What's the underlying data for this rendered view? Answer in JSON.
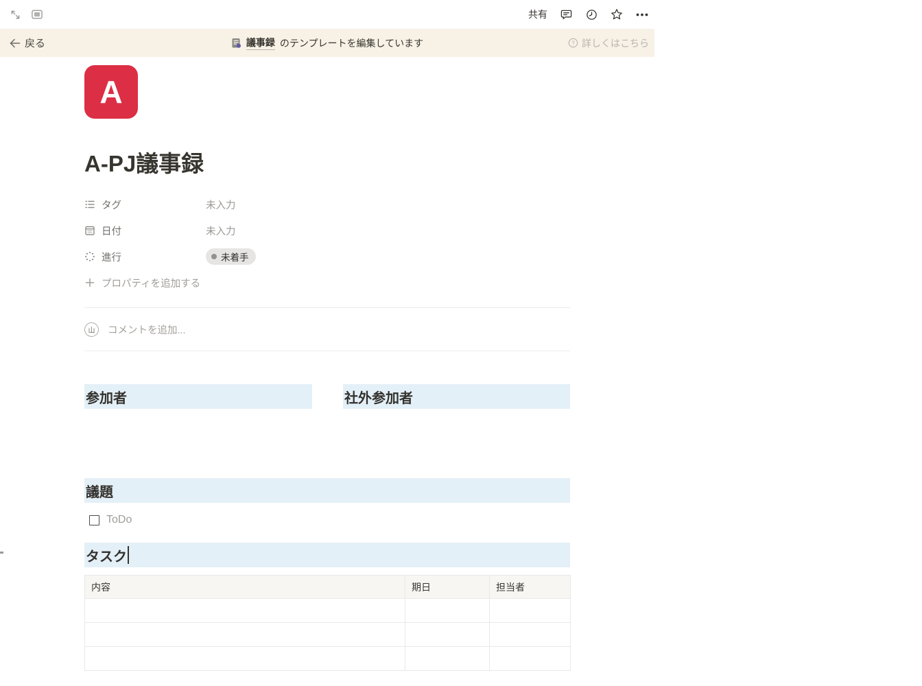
{
  "window": {
    "topbar": {
      "share_label": "共有"
    },
    "banner": {
      "back_label": "戻る",
      "doc_name": "議事録",
      "message_suffix": "のテンプレートを編集しています",
      "help_label": "詳しくはこちら"
    }
  },
  "page": {
    "icon_letter": "A",
    "title": "A-PJ議事録",
    "properties": [
      {
        "icon": "list-icon",
        "label": "タグ",
        "value": "未入力"
      },
      {
        "icon": "calendar-icon",
        "label": "日付",
        "value": "未入力"
      },
      {
        "icon": "status-icon",
        "label": "進行",
        "value": "未着手"
      }
    ],
    "add_property_label": "プロパティを追加する",
    "comment": {
      "avatar_initial": "山",
      "placeholder": "コメントを追加..."
    },
    "sections": {
      "participants": "参加者",
      "external_participants": "社外参加者",
      "agenda": "議題",
      "tasks": "タスク"
    },
    "todo_placeholder": "ToDo",
    "task_table": {
      "headers": [
        "内容",
        "期日",
        "担当者"
      ],
      "rows": [
        [
          "",
          "",
          ""
        ],
        [
          "",
          "",
          ""
        ],
        [
          "",
          "",
          ""
        ]
      ]
    }
  },
  "colors": {
    "banner_bg": "#f7f1e6",
    "heading_bg": "#e4f0f7",
    "table_header_bg": "#f7f6f2",
    "page_icon_bg": "#dc2e44",
    "pill_bg": "#e6e5e3",
    "pill_dot": "#91918e",
    "text_dark": "#37352f",
    "text_gray": "#72706c",
    "text_placeholder": "#9f9d99",
    "border": "#e9e9e7"
  }
}
